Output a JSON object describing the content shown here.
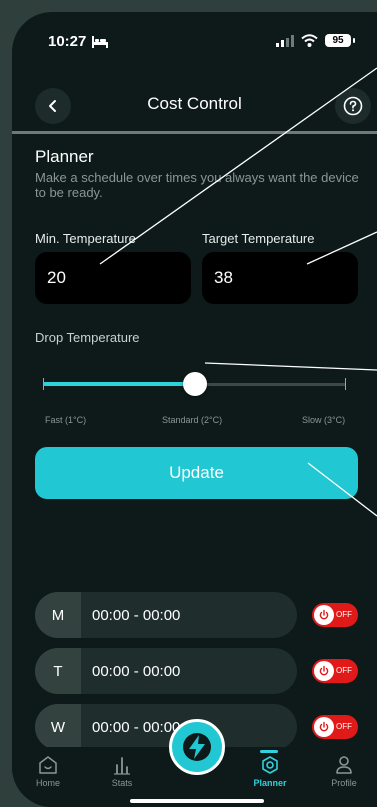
{
  "status_bar": {
    "time": "10:27",
    "battery": "95"
  },
  "header": {
    "title": "Cost Control",
    "back_icon": "chevron-left-icon",
    "help_icon": "help-circle-icon"
  },
  "planner": {
    "title": "Planner",
    "description": "Make a schedule over times you always want the device to be ready.",
    "min_temperature": {
      "label": "Min. Temperature",
      "value": "20"
    },
    "target_temperature": {
      "label": "Target Temperature",
      "value": "38"
    },
    "drop_temperature": {
      "label": "Drop Temperature",
      "options": [
        "Fast (1°C)",
        "Standard (2°C)",
        "Slow (3°C)"
      ],
      "selected_index": 1,
      "ticks": [
        0,
        0.5,
        1
      ]
    },
    "update_label": "Update"
  },
  "schedule": [
    {
      "day": "M",
      "time": "00:00 - 00:00",
      "toggle": "OFF"
    },
    {
      "day": "T",
      "time": "00:00 - 00:00",
      "toggle": "OFF"
    },
    {
      "day": "W",
      "time": "00:00 - 00:00",
      "toggle": "OFF"
    }
  ],
  "nav": {
    "items": [
      {
        "label": "Home",
        "icon": "home-icon",
        "active": false
      },
      {
        "label": "Stats",
        "icon": "stats-icon",
        "active": false
      },
      {
        "label": "Planner",
        "icon": "planner-icon",
        "active": true
      },
      {
        "label": "Profile",
        "icon": "profile-icon",
        "active": false
      }
    ],
    "center_icon": "lightning-icon"
  },
  "colors": {
    "accent": "#21c7d3",
    "toggle_off": "#e21919",
    "background": "#0d1a19"
  }
}
